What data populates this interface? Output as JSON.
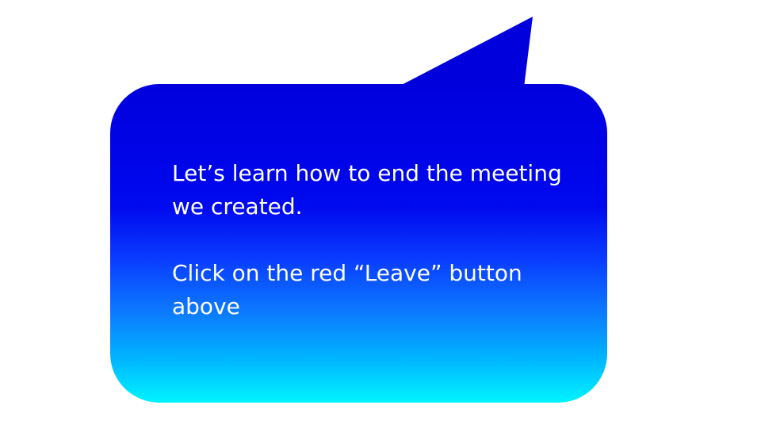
{
  "callout": {
    "line1": "Let’s learn how to end the meeting we created.",
    "line2": "Click on the red “Leave” button above"
  },
  "colors": {
    "bubble_top": "#0000dd",
    "bubble_bottom": "#00f4ff",
    "text": "#ffffff",
    "background": "#ffffff"
  }
}
